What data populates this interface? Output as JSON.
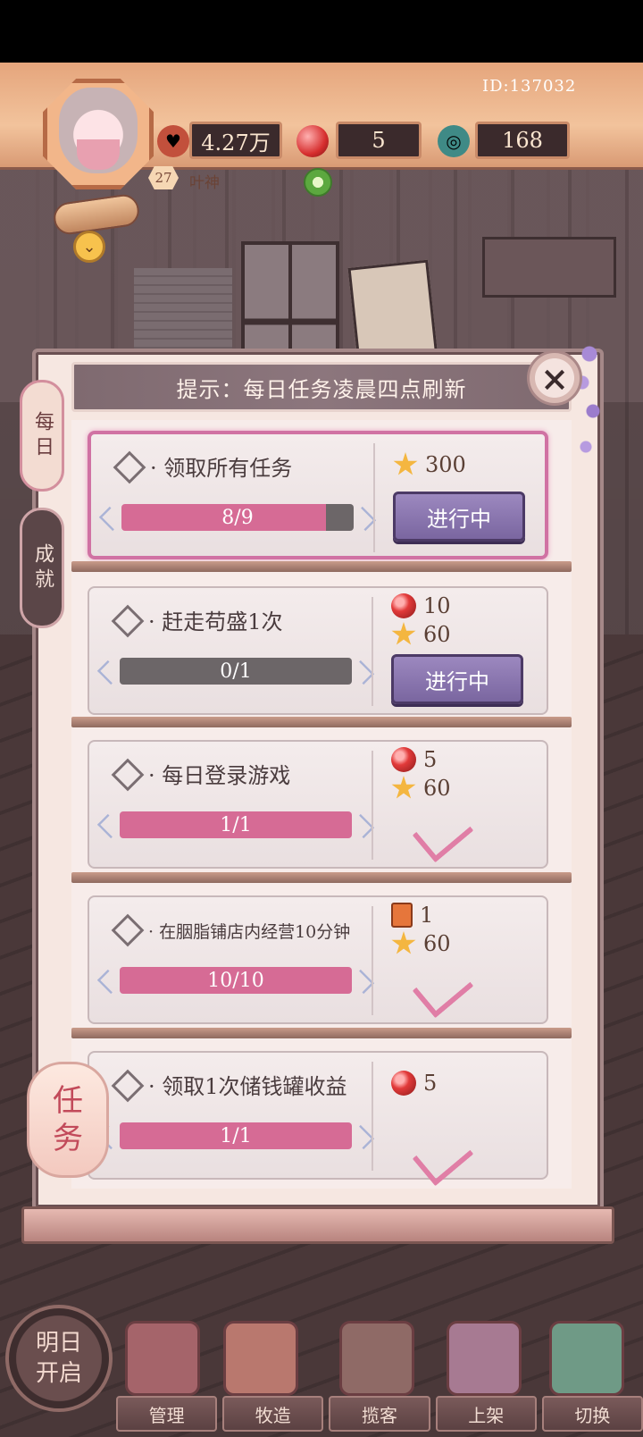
{
  "hud": {
    "player_id": "ID:137032",
    "hearts_value": "4.27万",
    "gems_value": "5",
    "coins_value": "168",
    "level": "27",
    "player_name": "叶神"
  },
  "panel": {
    "tip": "提示：每日任务凌晨四点刷新",
    "tabs": [
      {
        "label": "每日"
      },
      {
        "label": "成就"
      }
    ],
    "close_label": "×",
    "tasks": [
      {
        "name": "· 领取所有任务",
        "progress": "8/9",
        "rewards": [
          {
            "icon": "star-icon",
            "value": "300"
          }
        ],
        "status": "进行中"
      },
      {
        "name": "· 赶走苟盛1次",
        "progress": "0/1",
        "rewards": [
          {
            "icon": "red-gem-icon",
            "value": "10"
          },
          {
            "icon": "star-icon",
            "value": "60"
          }
        ],
        "status": "进行中"
      },
      {
        "name": "· 每日登录游戏",
        "progress": "1/1",
        "rewards": [
          {
            "icon": "red-gem-icon",
            "value": "5"
          },
          {
            "icon": "star-icon",
            "value": "60"
          }
        ],
        "status": "done"
      },
      {
        "name": "· 在胭脂铺店内经营10分钟",
        "progress": "10/10",
        "rewards": [
          {
            "icon": "card-icon",
            "value": "1"
          },
          {
            "icon": "star-icon",
            "value": "60"
          }
        ],
        "status": "done"
      },
      {
        "name": "· 领取1次储钱罐收益",
        "progress": "1/1",
        "rewards": [
          {
            "icon": "red-gem-icon",
            "value": "5"
          }
        ],
        "status": "done"
      }
    ]
  },
  "lantern_label": "任务",
  "tomorrow_label": "明日开启",
  "nav": {
    "manage": "管理",
    "craft": "牧造",
    "solicit": "揽客",
    "shelve": "上架",
    "switch": "切换"
  },
  "colors": {
    "progress_pink": "#d66b95",
    "progress_gray": "#6c6668",
    "button_purple": "#8b77b0",
    "check_pink": "#e07ea6"
  }
}
